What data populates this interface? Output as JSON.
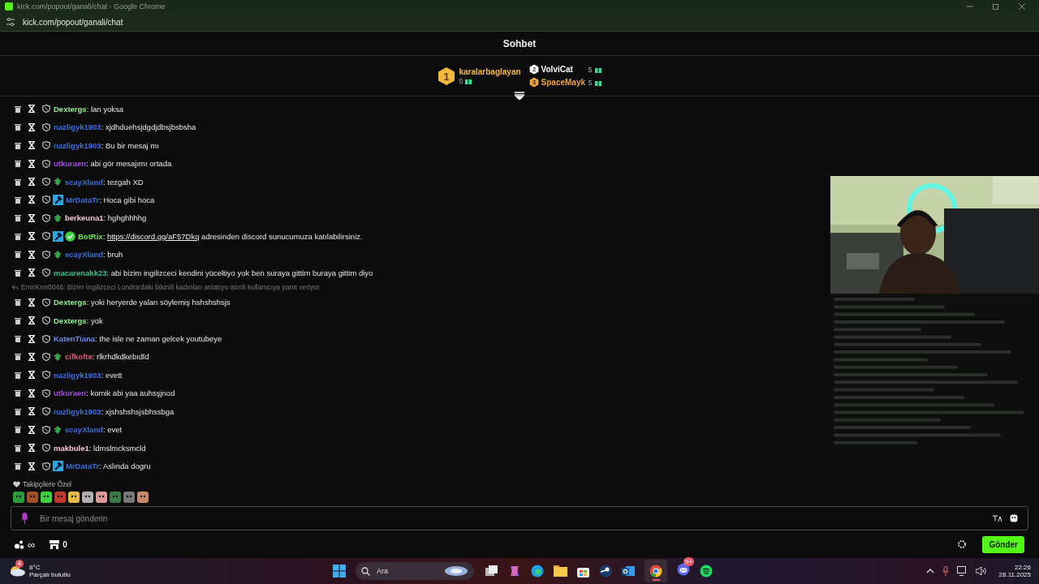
{
  "window": {
    "title": "kick.com/popout/ganali/chat - Google Chrome",
    "address": "kick.com/popout/ganali/chat"
  },
  "header": {
    "title": "Sohbet"
  },
  "leaderboard": [
    {
      "rank": "1",
      "name": "karalarbaglayan",
      "count": "5",
      "color": "#f5b83d"
    },
    {
      "rank": "2",
      "name": "VolviCat",
      "count": "5",
      "color": "#ffffff"
    },
    {
      "rank": "3",
      "name": "SpaceMayk",
      "count": "5",
      "color": "#f0a040"
    }
  ],
  "messages": [
    {
      "user": "Dextergs",
      "color": "#8ef08a",
      "message": ": lan yoksa"
    },
    {
      "user": "nazligyk1903",
      "color": "#3a6fe0",
      "message": ": xjdhduehsjdgdjdbsjbsbsha"
    },
    {
      "user": "nazligyk1903",
      "color": "#3a6fe0",
      "message": ": Bu bir mesaj mı"
    },
    {
      "user": "utkuraen",
      "color": "#a64de0",
      "message": ": abi gör mesajımı ortada"
    },
    {
      "user": "scayXland",
      "color": "#3a6fe0",
      "badges": [
        {
          "kind": "sub"
        }
      ],
      "message": ": tezgah XD"
    },
    {
      "user": "MrDataTr",
      "color": "#3a6fe0",
      "badges": [
        {
          "kind": "mod"
        }
      ],
      "message": ": Hoca gibi hoca"
    },
    {
      "user": "berkeuna1",
      "color": "#f4c6d6",
      "badges": [
        {
          "kind": "sub"
        }
      ],
      "message": ": hghghhhhg"
    },
    {
      "user": "BotRix",
      "color": "#6de04a",
      "badges": [
        {
          "kind": "mod"
        },
        {
          "kind": "verified"
        }
      ],
      "message": ": ",
      "link": "https://discord.gg/aF57Dkq",
      "message_end": " adresinden discord sunucumuza katılabilirsiniz."
    },
    {
      "user": "scayXland",
      "color": "#3a6fe0",
      "badges": [
        {
          "kind": "sub"
        }
      ],
      "message": ": bruh"
    },
    {
      "user": "macarenakk23",
      "color": "#3ac08a",
      "message": ": abi bizim ingilizceci kendini yüceltiyo yok ben suraya gittim buraya gittim diyo"
    },
    {
      "user": "Dextergs",
      "color": "#8ef08a",
      "reply": "EmirKrm0046: Bizim İngilizceci Londra'daki bikinili kadınları anlatıyo isimli kullanıcıya yanıt veriyor",
      "message": ": yoki heryerde yalan söylemiş hshshshsjs"
    },
    {
      "user": "Dextergs",
      "color": "#8ef08a",
      "message": ": yok"
    },
    {
      "user": "KatenTiana",
      "color": "#6a8ef0",
      "message": ": the isle ne zaman gelcek youtubeye"
    },
    {
      "user": "cifkofte",
      "color": "#e05a7a",
      "badges": [
        {
          "kind": "sub"
        }
      ],
      "message": ": rlkrhdkdkebıdld"
    },
    {
      "user": "nazligyk1903",
      "color": "#3a6fe0",
      "message": ": evett"
    },
    {
      "user": "utkuraen",
      "color": "#a64de0",
      "message": ": komik abi yaa auhsşjnod"
    },
    {
      "user": "nazligyk1903",
      "color": "#3a6fe0",
      "message": ": xjshshshsjsbhssbga"
    },
    {
      "user": "scayXland",
      "color": "#3a6fe0",
      "badges": [
        {
          "kind": "sub"
        }
      ],
      "message": ": evet"
    },
    {
      "user": "makbule1",
      "color": "#f4c6d6",
      "message": ": ldmslmcksmcld"
    },
    {
      "user": "MrDataTr",
      "color": "#3a6fe0",
      "badges": [
        {
          "kind": "mod"
        }
      ],
      "message": ": Aslında dogru"
    }
  ],
  "emotes": {
    "label": "Takipçilere Özel"
  },
  "composer": {
    "placeholder": "Bir mesaj gönderin",
    "send": "Gönder"
  },
  "footer": {
    "points": "∞",
    "store_count": "0"
  },
  "taskbar": {
    "weather_badge": "4",
    "temperature": "8°C",
    "weather": "Parçalı bulutlu",
    "search": "Ara",
    "discord_badge": "9+",
    "time": "22:26",
    "date": "28.11.2025"
  }
}
